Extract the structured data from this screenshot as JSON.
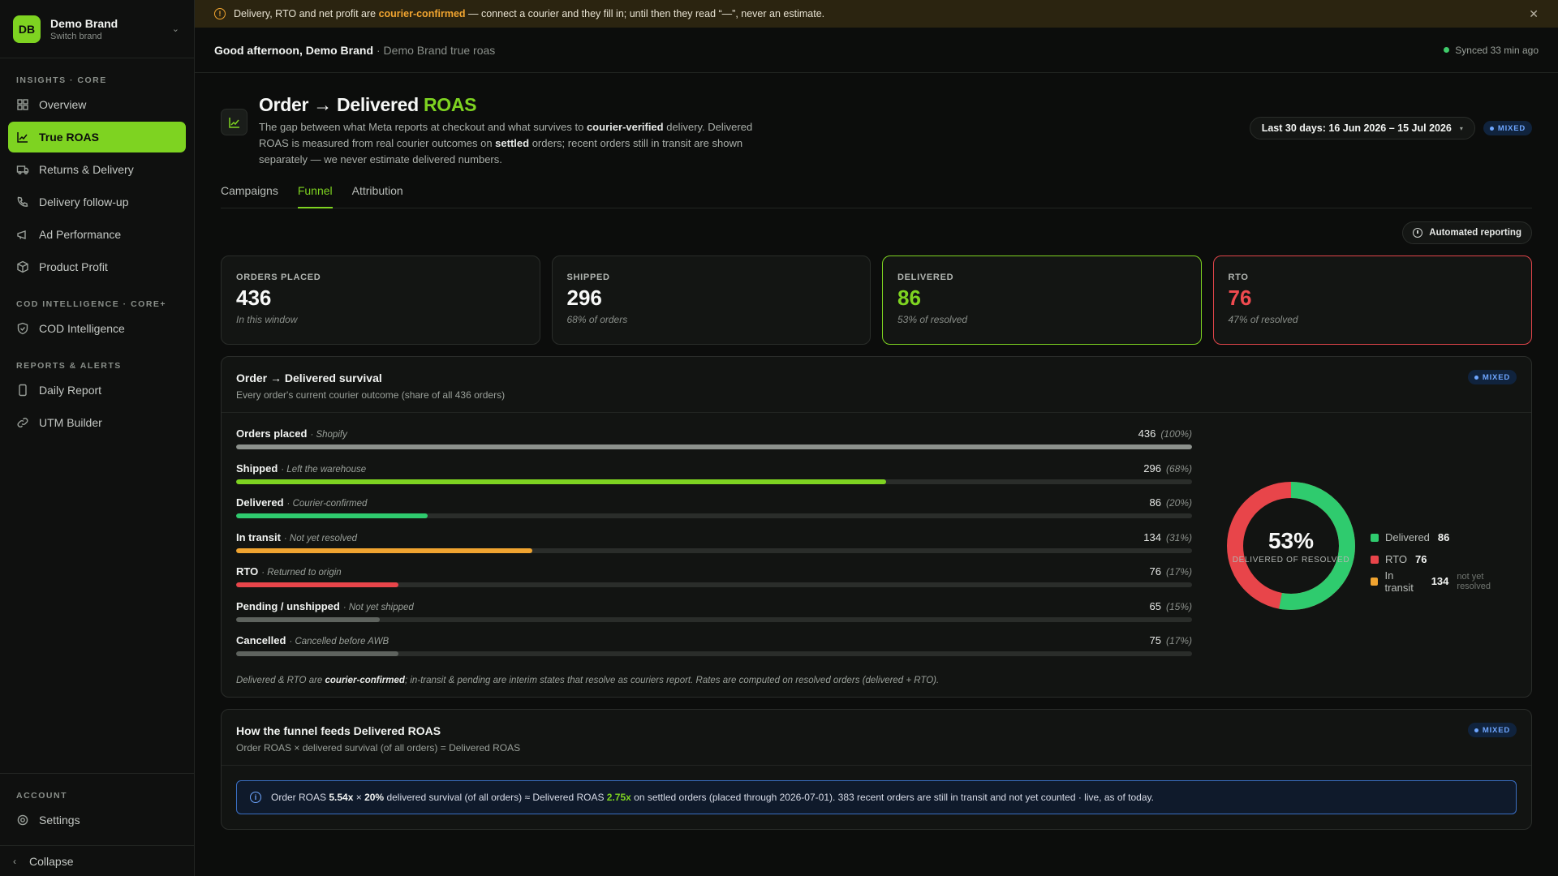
{
  "brand": {
    "initials": "DB",
    "name": "Demo Brand",
    "sub": "Switch brand"
  },
  "nav": {
    "sections": [
      {
        "heading": "INSIGHTS · CORE",
        "items": [
          {
            "label": "Overview",
            "icon": "grid-icon"
          },
          {
            "label": "True ROAS",
            "icon": "chart-line-icon",
            "active": true
          },
          {
            "label": "Returns & Delivery",
            "icon": "truck-icon"
          },
          {
            "label": "Delivery follow-up",
            "icon": "phone-icon"
          },
          {
            "label": "Ad Performance",
            "icon": "megaphone-icon"
          },
          {
            "label": "Product Profit",
            "icon": "box-icon"
          }
        ]
      },
      {
        "heading": "COD INTELLIGENCE · CORE+",
        "items": [
          {
            "label": "COD Intelligence",
            "icon": "shield-check-icon"
          }
        ]
      },
      {
        "heading": "REPORTS & ALERTS",
        "items": [
          {
            "label": "Daily Report",
            "icon": "mobile-icon"
          },
          {
            "label": "UTM Builder",
            "icon": "link-icon"
          }
        ]
      }
    ],
    "account_heading": "ACCOUNT",
    "settings_label": "Settings",
    "collapse_label": "Collapse"
  },
  "banner": {
    "pre": "Delivery, RTO and net profit are ",
    "highlight": "courier-confirmed",
    "post": " — connect a courier and they fill in; until then they read “—”, never an estimate."
  },
  "topbar": {
    "greeting": "Good afternoon, Demo Brand",
    "sub": "· Demo Brand true roas",
    "sync": "Synced 33 min ago"
  },
  "page": {
    "title_main": "Order → Delivered",
    "title_accent": "ROAS",
    "desc_1": "The gap between what Meta reports at checkout and what survives to ",
    "desc_b1": "courier-verified",
    "desc_2": " delivery. Delivered ROAS is measured from real courier outcomes on ",
    "desc_b2": "settled",
    "desc_3": " orders; recent orders still in transit are shown separately — we never estimate delivered numbers.",
    "date_range": "Last 30 days: 16 Jun 2026 – 15 Jul 2026",
    "badge": "MIXED"
  },
  "tabs": [
    "Campaigns",
    "Funnel",
    "Attribution"
  ],
  "automated_reporting": "Automated reporting",
  "kpis": [
    {
      "label": "ORDERS PLACED",
      "value": "436",
      "sub": "In this window",
      "variant": ""
    },
    {
      "label": "SHIPPED",
      "value": "296",
      "sub": "68% of orders",
      "variant": ""
    },
    {
      "label": "DELIVERED",
      "value": "86",
      "sub": "53% of resolved",
      "variant": "green"
    },
    {
      "label": "RTO",
      "value": "76",
      "sub": "47% of resolved",
      "variant": "red"
    }
  ],
  "survival": {
    "title": "Order → Delivered survival",
    "sub": "Every order's current courier outcome (share of all 436 orders)",
    "badge": "MIXED",
    "rows": [
      {
        "label": "Orders placed",
        "note": "· Shopify",
        "count": "436",
        "pct": "(100%)",
        "share": 100,
        "color": "#8c918c"
      },
      {
        "label": "Shipped",
        "note": "· Left the warehouse",
        "count": "296",
        "pct": "(68%)",
        "share": 68,
        "color": "#7ed321"
      },
      {
        "label": "Delivered",
        "note": "· Courier-confirmed",
        "count": "86",
        "pct": "(20%)",
        "share": 20,
        "color": "#2fcb6e"
      },
      {
        "label": "In transit",
        "note": "· Not yet resolved",
        "count": "134",
        "pct": "(31%)",
        "share": 31,
        "color": "#f0a430"
      },
      {
        "label": "RTO",
        "note": "· Returned to origin",
        "count": "76",
        "pct": "(17%)",
        "share": 17,
        "color": "#e8454a"
      },
      {
        "label": "Pending / unshipped",
        "note": "· Not yet shipped",
        "count": "65",
        "pct": "(15%)",
        "share": 15,
        "color": "#5e635e"
      },
      {
        "label": "Cancelled",
        "note": "· Cancelled before AWB",
        "count": "75",
        "pct": "(17%)",
        "share": 17,
        "color": "#5e635e"
      }
    ],
    "foot_1": "Delivered & RTO are ",
    "foot_b": "courier-confirmed",
    "foot_2": "; in-transit & pending are interim states that resolve as couriers report. Rates are computed on resolved orders (delivered + RTO).",
    "donut": {
      "pct": "53%",
      "label": "DELIVERED OF RESOLVED",
      "delivered_share": 53,
      "legend": [
        {
          "label": "Delivered",
          "value": "86",
          "note": "",
          "color": "#2fcb6e"
        },
        {
          "label": "RTO",
          "value": "76",
          "note": "",
          "color": "#e8454a"
        },
        {
          "label": "In transit",
          "value": "134",
          "note": "not yet resolved",
          "color": "#f0a430"
        }
      ]
    }
  },
  "feed": {
    "title": "How the funnel feeds Delivered ROAS",
    "sub": "Order ROAS × delivered survival (of all orders) = Delivered ROAS",
    "badge": "MIXED",
    "t1": "Order ROAS ",
    "b1": "5.54x",
    "t2": " × ",
    "b2": "20%",
    "t3": " delivered survival (of all orders) ≈ Delivered ROAS ",
    "g1": "2.75x",
    "t4": " on settled orders (placed through 2026-07-01). 383 recent orders are still in transit and not yet counted · live, as of today."
  }
}
